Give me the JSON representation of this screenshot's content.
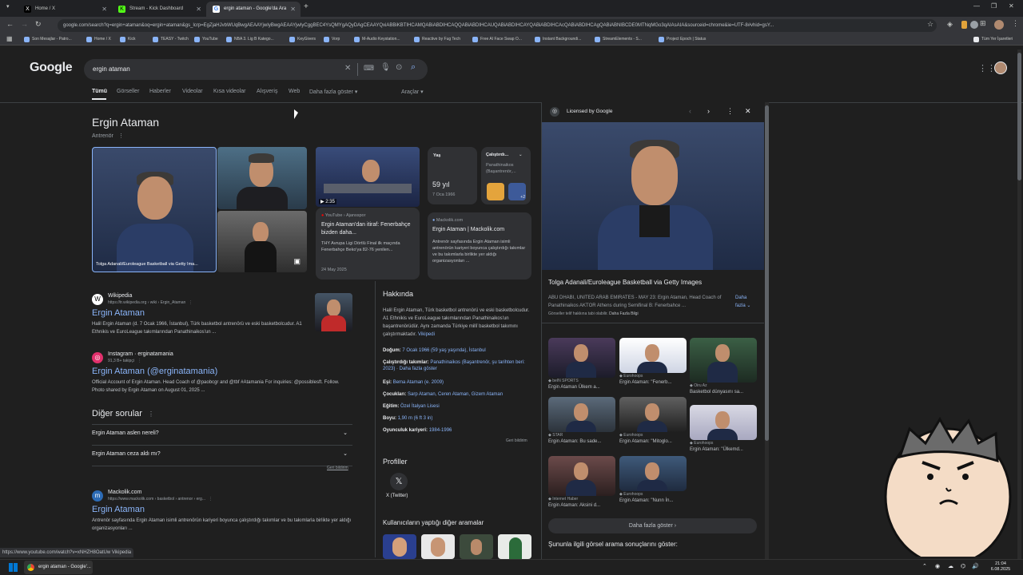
{
  "browser": {
    "tabs": [
      {
        "label": "Home / X",
        "icon": "x-icon"
      },
      {
        "label": "Stream - Kick Dashboard",
        "icon": "kick-icon"
      },
      {
        "label": "ergin ataman - Google'da Ara",
        "icon": "google-icon"
      }
    ],
    "url": "google.com/search?q=ergin+ataman&oq=ergin+ataman&gs_lcrp=EgZjaHJvbWUqBwgAEAAYjwIyBwgAEAAYjwIyCggBEC4YsQMYgAQyDAgCEAAYQxiABBiKBTIHCAMQABiABDIHCAQQABiABDIHCAUQABiABDIHCAYQABiABDIHCAcQABiABDIHCAgQABiABNIBCDE0MTNqMGo3qAIAsAIA&sourceid=chrome&ie=UTF-8#vhid=gsY...",
    "bookmarks": [
      "Son Mesajlar - Patro...",
      "Home / X",
      "Kick",
      "TEASY - Twitch",
      "YouTube",
      "NBA 3. Lig B Katego...",
      "KeyGivers",
      "Vorp",
      "M-Audio Keystation...",
      "Reactive by Fug Tech",
      "Free AI Face Swap O...",
      "Instant Backgroundi...",
      "StreamElements - S...",
      "Project Epoch | Status"
    ],
    "all_bookmarks": "Tüm Yer İşaretleri"
  },
  "search": {
    "query": "ergin ataman",
    "tabs": [
      "Tümü",
      "Görseller",
      "Haberler",
      "Videolar",
      "Kısa videolar",
      "Alışveriş",
      "Web",
      "Daha fazla göster"
    ],
    "tools": "Araçlar"
  },
  "entity": {
    "name": "Ergin Ataman",
    "subtitle": "Antrenör",
    "main_image_caption": "Tolga Adanali/Euroleague Basketball via Getty Ima...",
    "video_duration": "2:35",
    "video_source": "YouTube › Ajansspor",
    "video_title": "Ergin Ataman'dan itiraf: Fenerbahçe bizden daha...",
    "video_desc": "THY Avrupa Ligi Dörtlü Final ilk maçında Fenerbahçe Beko'ya 82-76 yenilen...",
    "video_date": "24 May 2025",
    "age_label": "Yaş",
    "age_value": "59 yıl",
    "age_date": "7 Oca 1966",
    "club_label": "Çalıştırdı...",
    "club_value": "Panathinaikos (Başantrenör,...",
    "club_more": "+2",
    "mackolik_source": "Mackolik.com",
    "mackolik_title": "Ergin Ataman | Mackolik.com",
    "mackolik_desc": "Antrenör sayfasında Ergin Ataman isimli antrenörün kariyeri boyunca çalıştırdığı takımlar ve bu takımlarla birlikte yer aldığı organizasyonları ..."
  },
  "results": [
    {
      "site": "Wikipedia",
      "url": "https://tr.wikipedia.org › wiki › Ergin_Ataman",
      "title": "Ergin Ataman",
      "snippet": "Halil Ergin Ataman (d. 7 Ocak 1966, İstanbul), Türk basketbol antrenörü ve eski basketbolcudur. A1 Ethnikis ve EuroLeague takımlarından Panathinaikos'un ..."
    },
    {
      "site": "Instagram · erginatamania",
      "url": "91,3 B+ takipçi",
      "title": "Ergin Ataman (@erginatamania)",
      "snippet": "Official Account of Ergin Ataman. Head Coach of @paobcgr and @tbf #Atamania For inquiries: @possiblesft. Follow. Photo shared by Ergin Ataman on August 01, 2025 ..."
    },
    {
      "site": "Mackolik.com",
      "url": "https://www.mackolik.com › basketbol › antrenor › erg...",
      "title": "Ergin Ataman",
      "snippet": "Antrenör sayfasında Ergin Ataman isimli antrenörün kariyeri boyunca çalıştırdığı takımlar ve bu takımlarla birlikte yer aldığı organizasyonları ..."
    }
  ],
  "paa": {
    "title": "Diğer sorular",
    "questions": [
      "Ergin Ataman aslen nereli?",
      "Ergin Ataman ceza aldı mı?"
    ],
    "feedback": "Geri bildirim"
  },
  "about": {
    "title": "Hakkında",
    "text": "Halil Ergin Ataman, Türk basketbol antrenörü ve eski basketbolcudur. A1 Ethnikis ve EuroLeague takımlarından Panathinaikos'un başantrenörüdür. Aynı zamanda Türkiye millî basketbol takımını çalıştırmaktadır.",
    "source": "Vikipedi",
    "facts": [
      {
        "k": "Doğum:",
        "v": "7 Ocak 1966 (59 yaş yaşında), İstanbul"
      },
      {
        "k": "Çalıştırdığı takımlar:",
        "v": "Panathinaikos (Başantrenör, şu tarihten beri: 2023) · Daha fazla göster"
      },
      {
        "k": "Eşi:",
        "v": "Bema Ataman (e. 2009)"
      },
      {
        "k": "Çocukları:",
        "v": "Sarp Ataman, Ceren Ataman, Gizem Ataman"
      },
      {
        "k": "Eğitim:",
        "v": "Özel İtalyan Lisesi"
      },
      {
        "k": "Boyu:",
        "v": "1,90 m (6 ft 3 in)"
      },
      {
        "k": "Oyunculuk kariyeri:",
        "v": "1984-1996"
      }
    ],
    "feedback": "Geri bildirim",
    "profiles_title": "Profiller",
    "profile_x": "X (Twitter)",
    "others_title": "Kullanıcıların yaptığı diğer aramalar"
  },
  "viewer": {
    "licensed": "Licensed by Google",
    "title": "Tolga Adanali/Euroleague Basketball via Getty Images",
    "desc": "ABU DHABI, UNITED ARAB EMIRATES - MAY 23: Ergin Ataman, Head Coach of Panathinaikos AKTOR Athens during Semifinal B: Fenerbahce ...",
    "more": "Daha fazla",
    "copyright": "Görseller telif hakkına tabi olabilir.",
    "copyright_link": "Daha Fazla Bilgi",
    "related": [
      {
        "src": "beIN SPORTS",
        "cap": "Ergin Ataman Ülkem a..."
      },
      {
        "src": "Eurohoops",
        "cap": "Ergin Ataman: \"Fenerb..."
      },
      {
        "src": "Oiru Az",
        "cap": "Basketbol dünyasını sa..."
      },
      {
        "src": "STAR",
        "cap": "Ergin Ataman: Bu sade..."
      },
      {
        "src": "Eurohoops",
        "cap": "Ergin Ataman: \"Mitoglo..."
      },
      {
        "src": "Eurohoops",
        "cap": "Ergin Ataman: \"Ülkemd..."
      },
      {
        "src": "Internet Haber",
        "cap": "Ergin Ataman: Aksini d..."
      },
      {
        "src": "Eurohoops",
        "cap": "Ergin Ataman: \"Nunn İn..."
      }
    ],
    "show_more": "Daha fazla göster",
    "bottom": "Şununla ilgili görsel arama sonuçlarını göster:"
  },
  "status_url": "https://www.youtube.com/watch?v=xNHZH8OatUw",
  "status_tail": "Vikipedia",
  "taskbar": {
    "window": "ergin ataman - Google'...",
    "time": "21:04",
    "date": "6.08.2025"
  }
}
